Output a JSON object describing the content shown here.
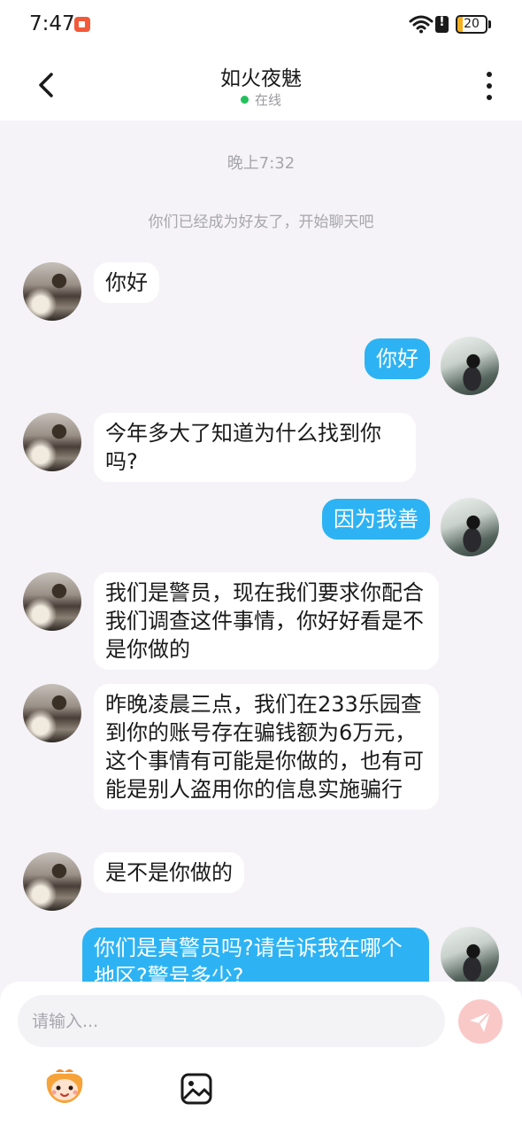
{
  "status_bar": {
    "time": "7:47",
    "battery": "20",
    "battery_level": 0.2,
    "icons": [
      "screen-record-icon",
      "wifi-icon",
      "alert-icon",
      "battery-icon"
    ]
  },
  "header": {
    "title": "如火夜魅",
    "status": "在线",
    "online_color": "#22c05c"
  },
  "chat": {
    "timestamp": "晚上7:32",
    "system_note": "你们已经成为好友了，开始聊天吧",
    "messages": [
      {
        "from": "contact",
        "text": "你好"
      },
      {
        "from": "me",
        "text": "你好"
      },
      {
        "from": "contact",
        "text": "今年多大了知道为什么找到你吗?"
      },
      {
        "from": "me",
        "text": "因为我善"
      },
      {
        "from": "contact",
        "text": "我们是警员，现在我们要求你配合我们调查这件事情，你好好看是不是你做的"
      },
      {
        "from": "contact",
        "text": "昨晚凌晨三点，我们在233乐园查到你的账号存在骗钱额为6万元，这个事情有可能是你做的，也有可能是别人盗用你的信息实施骗行"
      },
      {
        "from": "contact",
        "text": "是不是你做的"
      },
      {
        "from": "me",
        "text": "你们是真警员吗?请告诉我在哪个地区?警号多少?"
      }
    ]
  },
  "composer": {
    "placeholder": "请输入..."
  },
  "colors": {
    "outgoing_bubble": "#2db3f3",
    "incoming_bubble": "#ffffff",
    "background": "#f5f3f7",
    "send_button": "#f9c9c8"
  }
}
